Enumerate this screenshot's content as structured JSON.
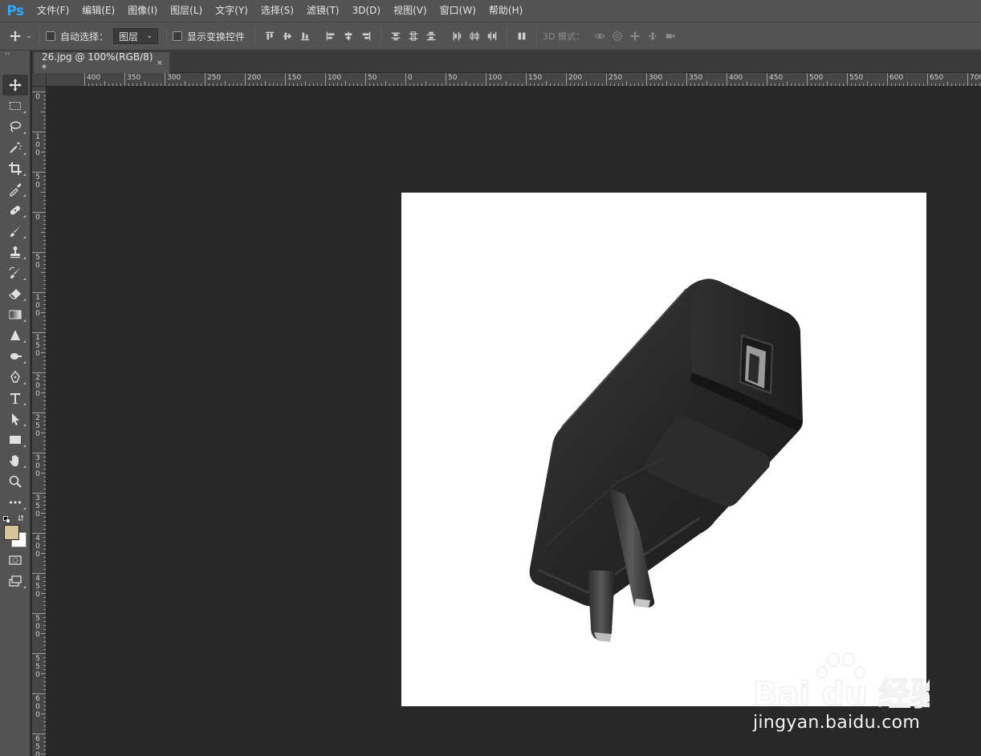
{
  "app": {
    "logo": "Ps"
  },
  "menu": [
    "文件(F)",
    "编辑(E)",
    "图像(I)",
    "图层(L)",
    "文字(Y)",
    "选择(S)",
    "滤镜(T)",
    "3D(D)",
    "视图(V)",
    "窗口(W)",
    "帮助(H)"
  ],
  "options": {
    "auto_select_label": "自动选择：",
    "auto_select_value": "图层",
    "show_transform_label": "显示变换控件",
    "mode_3d_label": "3D 模式："
  },
  "document": {
    "tab_title": "26.jpg @ 100%(RGB/8) *",
    "close_symbol": "×"
  },
  "rulers": {
    "top_labels": [
      "400",
      "350",
      "300",
      "250",
      "200",
      "150",
      "100",
      "50",
      "0",
      "50",
      "100",
      "150",
      "200",
      "250",
      "300",
      "350",
      "400",
      "450",
      "500",
      "550",
      "600",
      "650",
      "700"
    ],
    "left_labels": [
      "0",
      "100",
      "50",
      "0",
      "50",
      "100",
      "150",
      "200",
      "250",
      "300",
      "350",
      "400",
      "450",
      "500",
      "550",
      "600",
      "650"
    ]
  },
  "colors": {
    "foreground": "#d8c49a",
    "background": "#ffffff",
    "accent": "#31a8ff"
  },
  "tools": [
    "move-tool",
    "marquee-tool",
    "lasso-tool",
    "magic-wand-tool",
    "crop-tool",
    "eyedropper-tool",
    "healing-brush-tool",
    "brush-tool",
    "clone-stamp-tool",
    "history-brush-tool",
    "eraser-tool",
    "gradient-tool",
    "blur-tool",
    "dodge-tool",
    "pen-tool",
    "type-tool",
    "path-selection-tool",
    "rectangle-tool",
    "hand-tool",
    "zoom-tool",
    "more-tools"
  ],
  "watermark": {
    "brand": "Bai du 经验",
    "url": "jingyan.baidu.com"
  }
}
